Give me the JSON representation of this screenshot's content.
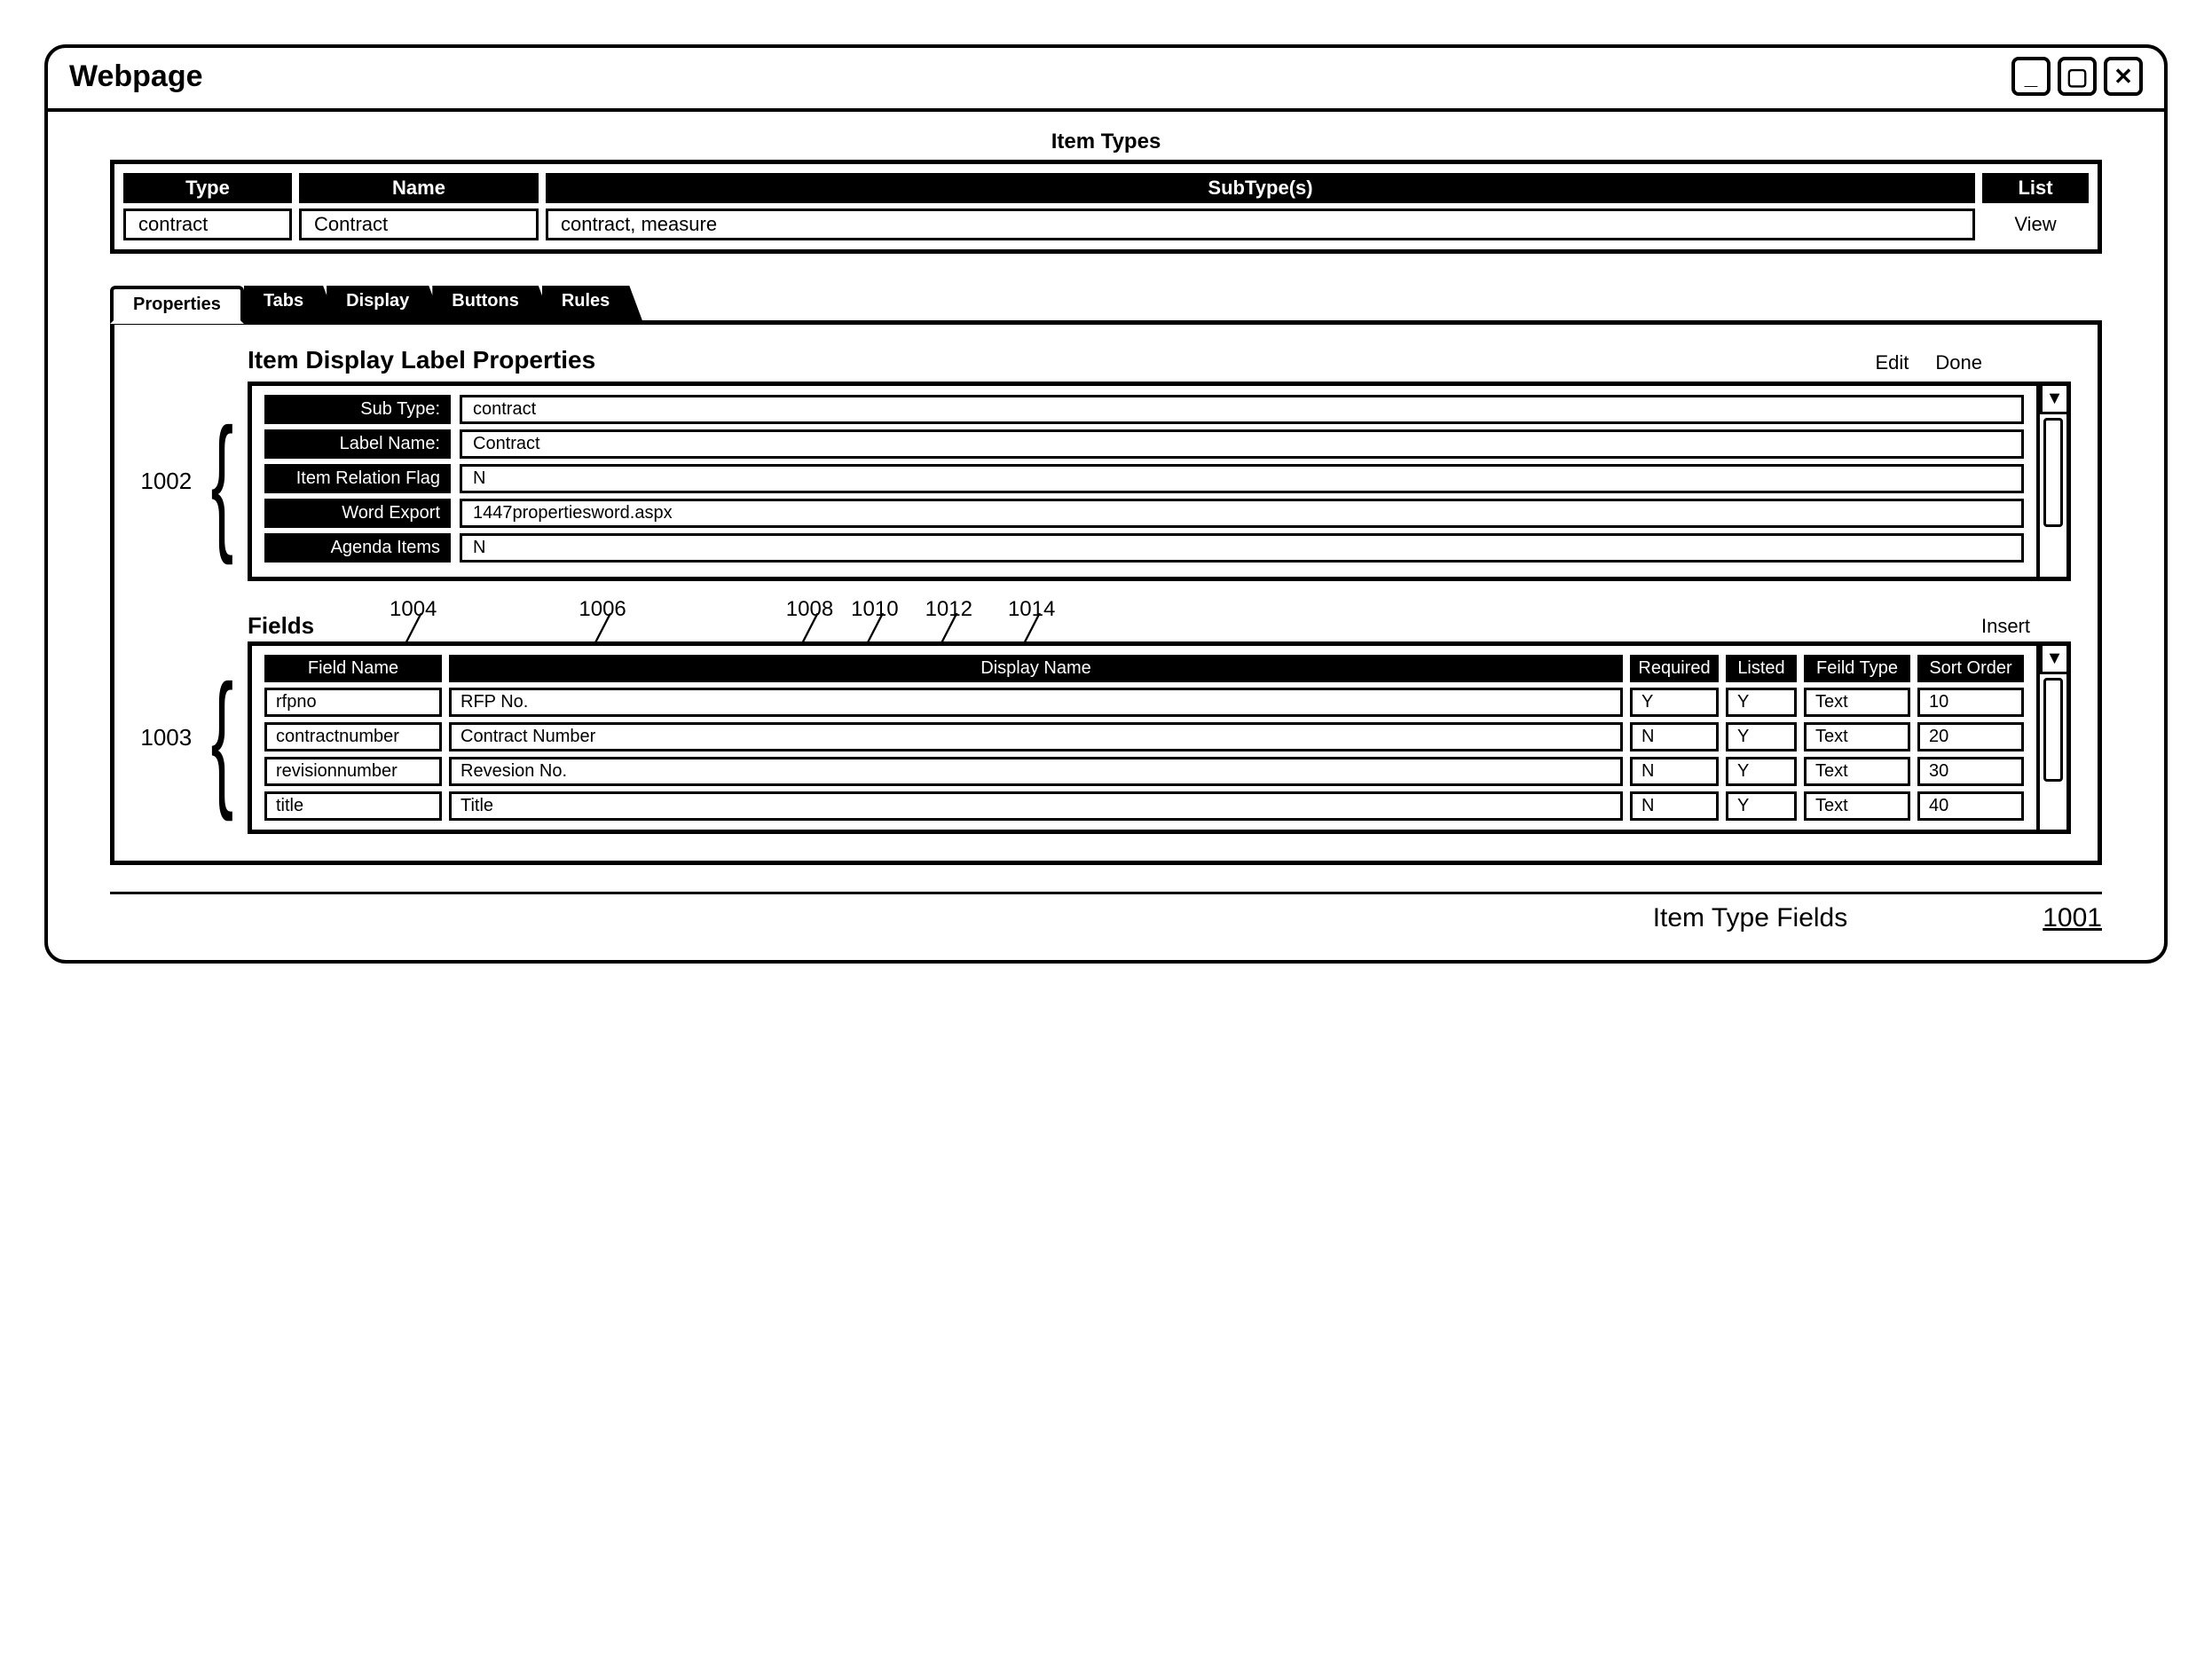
{
  "window": {
    "title": "Webpage"
  },
  "item_types": {
    "title": "Item Types",
    "headers": {
      "type": "Type",
      "name": "Name",
      "subtypes": "SubType(s)",
      "list": "List"
    },
    "row": {
      "type": "contract",
      "name": "Contract",
      "subtypes": "contract, measure",
      "list_action": "View"
    }
  },
  "tabs": [
    {
      "label": "Properties",
      "active": true
    },
    {
      "label": "Tabs",
      "active": false
    },
    {
      "label": "Display",
      "active": false
    },
    {
      "label": "Buttons",
      "active": false
    },
    {
      "label": "Rules",
      "active": false
    }
  ],
  "properties": {
    "heading": "Item Display Label Properties",
    "actions": {
      "edit": "Edit",
      "done": "Done"
    },
    "rows": [
      {
        "label": "Sub Type:",
        "value": "contract"
      },
      {
        "label": "Label Name:",
        "value": "Contract"
      },
      {
        "label": "Item Relation Flag",
        "value": "N"
      },
      {
        "label": "Word Export",
        "value": "1447propertiesword.aspx"
      },
      {
        "label": "Agenda Items",
        "value": "N"
      }
    ],
    "brace_ref": "1002"
  },
  "annotations": {
    "col_refs": [
      "1004",
      "1006",
      "1008",
      "1010",
      "1012",
      "1014"
    ]
  },
  "fields": {
    "label": "Fields",
    "insert": "Insert",
    "brace_ref": "1003",
    "headers": {
      "fname": "Field Name",
      "dname": "Display Name",
      "req": "Required",
      "listed": "Listed",
      "ftype": "Feild Type",
      "sort": "Sort Order"
    },
    "rows": [
      {
        "fname": "rfpno",
        "dname": "RFP No.",
        "req": "Y",
        "listed": "Y",
        "ftype": "Text",
        "sort": "10"
      },
      {
        "fname": "contractnumber",
        "dname": "Contract Number",
        "req": "N",
        "listed": "Y",
        "ftype": "Text",
        "sort": "20"
      },
      {
        "fname": "revisionnumber",
        "dname": "Revesion No.",
        "req": "N",
        "listed": "Y",
        "ftype": "Text",
        "sort": "30"
      },
      {
        "fname": "title",
        "dname": "Title",
        "req": "N",
        "listed": "Y",
        "ftype": "Text",
        "sort": "40"
      }
    ]
  },
  "footer": {
    "label": "Item Type Fields",
    "fig_ref": "1001"
  }
}
